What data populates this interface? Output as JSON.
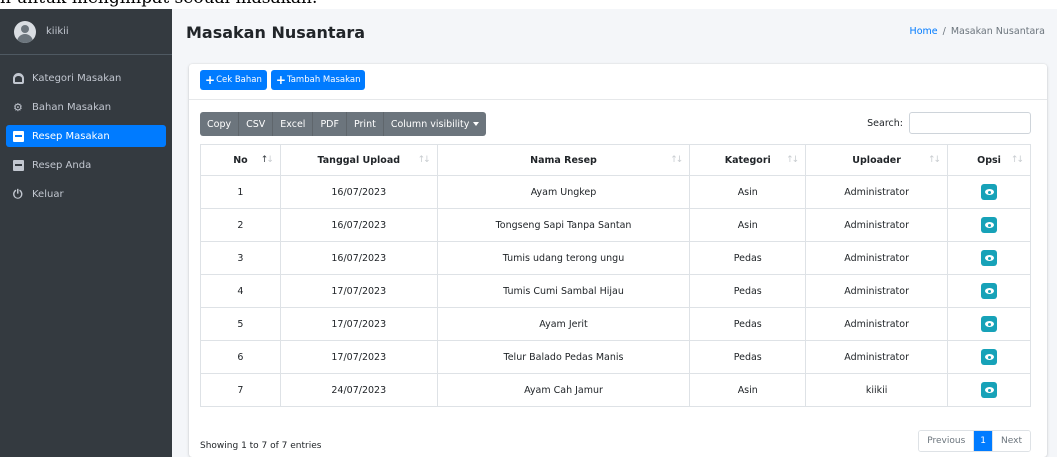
{
  "page_top_text": "n untuk mengimpat seoual masakan.",
  "sidebar": {
    "user_name": "kiikii",
    "items": [
      {
        "label": "Kategori Masakan",
        "icon": "chef-hat-icon",
        "active": false
      },
      {
        "label": "Bahan Masakan",
        "icon": "gears-icon",
        "active": false
      },
      {
        "label": "Resep Masakan",
        "icon": "book-icon",
        "active": true
      },
      {
        "label": "Resep Anda",
        "icon": "book-icon",
        "active": false
      },
      {
        "label": "Keluar",
        "icon": "power-icon",
        "active": false
      }
    ]
  },
  "header": {
    "title": "Masakan Nusantara",
    "breadcrumb_home": "Home",
    "breadcrumb_separator": "/",
    "breadcrumb_current": "Masakan Nusantara"
  },
  "actions": {
    "cek_bahan_label": "Cek Bahan",
    "tambah_masakan_label": "Tambah Masakan"
  },
  "toolbar": {
    "copy": "Copy",
    "csv": "CSV",
    "excel": "Excel",
    "pdf": "PDF",
    "print": "Print",
    "column_visibility": "Column visibility"
  },
  "search": {
    "label": "Search:",
    "value": ""
  },
  "table": {
    "columns": [
      "No",
      "Tanggal Upload",
      "Nama Resep",
      "Kategori",
      "Uploader",
      "Opsi"
    ],
    "rows": [
      [
        "1",
        "16/07/2023",
        "Ayam Ungkep",
        "Asin",
        "Administrator"
      ],
      [
        "2",
        "16/07/2023",
        "Tongseng Sapi Tanpa Santan",
        "Asin",
        "Administrator"
      ],
      [
        "3",
        "16/07/2023",
        "Tumis udang terong ungu",
        "Pedas",
        "Administrator"
      ],
      [
        "4",
        "17/07/2023",
        "Tumis Cumi Sambal Hijau",
        "Pedas",
        "Administrator"
      ],
      [
        "5",
        "17/07/2023",
        "Ayam Jerit",
        "Pedas",
        "Administrator"
      ],
      [
        "6",
        "17/07/2023",
        "Telur Balado Pedas Manis",
        "Pedas",
        "Administrator"
      ],
      [
        "7",
        "24/07/2023",
        "Ayam Cah Jamur",
        "Asin",
        "kiikii"
      ]
    ]
  },
  "footer": {
    "info": "Showing 1 to 7 of 7 entries",
    "previous": "Previous",
    "page": "1",
    "next": "Next"
  },
  "colors": {
    "sidebar_bg": "#343a40",
    "primary": "#007bff",
    "info_button": "#17a2b8",
    "toolbar_bg": "#6c757d",
    "content_bg": "#f4f6f9"
  }
}
